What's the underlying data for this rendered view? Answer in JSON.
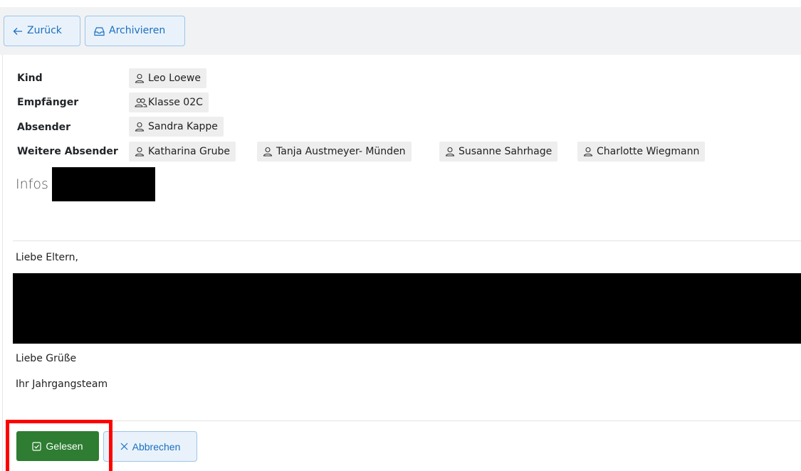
{
  "toolbar": {
    "back_label": "Zurück",
    "archive_label": "Archivieren"
  },
  "meta": {
    "kind_label": "Kind",
    "kind_value": "Leo Loewe",
    "recipient_label": "Empfänger",
    "recipient_value": "Klasse 02C",
    "sender_label": "Absender",
    "sender_value": "Sandra Kappe",
    "more_senders_label": "Weitere Absender",
    "more_senders": [
      "Katharina Grube",
      "Tanja Austmeyer- Münden",
      "Susanne Sahrhage",
      "Charlotte Wiegmann"
    ]
  },
  "message": {
    "subject_prefix": "Infos",
    "greeting": "Liebe Eltern,",
    "closing": "Liebe Grüße",
    "signature": "Ihr Jahrgangsteam"
  },
  "actions": {
    "read_label": "Gelesen",
    "cancel_label": "Abbrechen"
  },
  "colors": {
    "primary_outline": "#1b6fbf",
    "success": "#2e7d32",
    "highlight": "#ff0000"
  }
}
